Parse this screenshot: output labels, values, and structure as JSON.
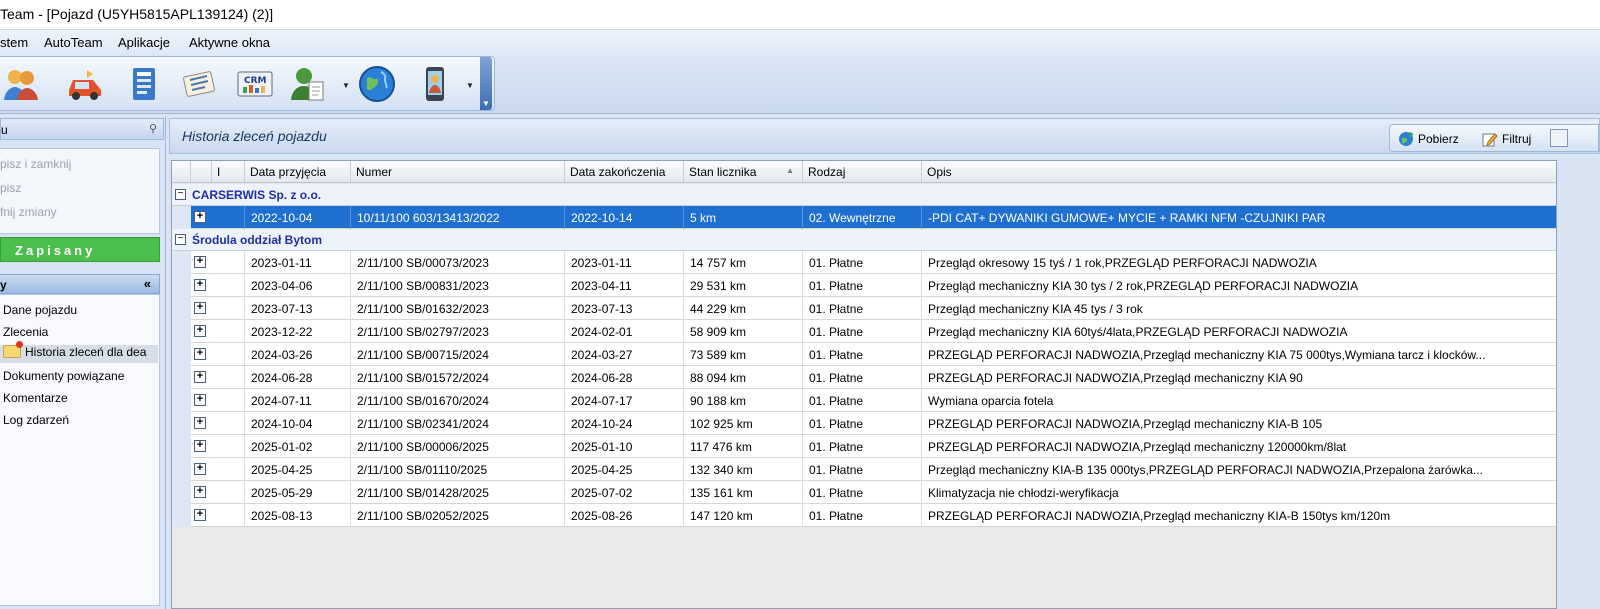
{
  "window": {
    "title": "Team - [Pojazd (U5YH5815APL139124) (2)]"
  },
  "menu": [
    {
      "label": "stem"
    },
    {
      "label": "AutoTeam"
    },
    {
      "label": "Aplikacje"
    },
    {
      "label": "Aktywne okna"
    }
  ],
  "toolbar": {
    "icons": [
      "customers-icon",
      "car-icon",
      "document-icon",
      "notes-icon",
      "crm-icon",
      "user-document-icon",
      "globe-icon",
      "mobile-icon"
    ]
  },
  "left_panel": {
    "header_label": "u",
    "actions": [
      "pisz i zamknij",
      "pisz",
      "fnij zmiany"
    ],
    "saved_label": "Zapisany",
    "nav_header": "y",
    "nav_items": [
      "Dane pojazdu",
      "Zlecenia",
      "Historia zleceń dla dea",
      "Dokumenty powiązane",
      "Komentarze",
      "Log zdarzeń"
    ]
  },
  "main": {
    "title": "Historia zleceń pojazdu",
    "buttons": {
      "fetch": "Pobierz",
      "filter": "Filtruj"
    }
  },
  "grid": {
    "columns": [
      "I",
      "Data przyjęcia",
      "Numer",
      "Data zakończenia",
      "Stan licznika",
      "Rodzaj",
      "Opis"
    ],
    "sort_indicator": "▲",
    "groups": [
      {
        "name": "CARSERWIS Sp. z o.o.",
        "rows": [
          {
            "data_przyjecia": "2022-10-04",
            "numer": "10/11/100 603/13413/2022",
            "data_zakonczenia": "2022-10-14",
            "stan_licznika": "5 km",
            "rodzaj": "02. Wewnętrzne",
            "opis": "-PDI CAT+ DYWANIKI GUMOWE+ MYCIE + RAMKI NFM -CZUJNIKI PAR"
          }
        ]
      },
      {
        "name": "Środula oddział Bytom",
        "rows": [
          {
            "data_przyjecia": "2023-01-11",
            "numer": "2/11/100 SB/00073/2023",
            "data_zakonczenia": "2023-01-11",
            "stan_licznika": "14 757 km",
            "rodzaj": "01. Płatne",
            "opis": "Przegląd okresowy 15 tyś / 1 rok,PRZEGLĄD PERFORACJI NADWOZIA"
          },
          {
            "data_przyjecia": "2023-04-06",
            "numer": "2/11/100 SB/00831/2023",
            "data_zakonczenia": "2023-04-11",
            "stan_licznika": "29 531 km",
            "rodzaj": "01. Płatne",
            "opis": "Przegląd mechaniczny KIA 30 tys / 2 rok,PRZEGLĄD PERFORACJI NADWOZIA"
          },
          {
            "data_przyjecia": "2023-07-13",
            "numer": "2/11/100 SB/01632/2023",
            "data_zakonczenia": "2023-07-13",
            "stan_licznika": "44 229 km",
            "rodzaj": "01. Płatne",
            "opis": "Przegląd mechaniczny KIA 45 tys / 3 rok"
          },
          {
            "data_przyjecia": "2023-12-22",
            "numer": "2/11/100 SB/02797/2023",
            "data_zakonczenia": "2024-02-01",
            "stan_licznika": "58 909 km",
            "rodzaj": "01. Płatne",
            "opis": "Przegląd mechaniczny KIA 60tyś/4lata,PRZEGLĄD PERFORACJI NADWOZIA"
          },
          {
            "data_przyjecia": "2024-03-26",
            "numer": "2/11/100 SB/00715/2024",
            "data_zakonczenia": "2024-03-27",
            "stan_licznika": "73 589 km",
            "rodzaj": "01. Płatne",
            "opis": "PRZEGLĄD PERFORACJI NADWOZIA,Przegląd mechaniczny KIA 75 000tys,Wymiana tarcz i klocków..."
          },
          {
            "data_przyjecia": "2024-06-28",
            "numer": "2/11/100 SB/01572/2024",
            "data_zakonczenia": "2024-06-28",
            "stan_licznika": "88 094 km",
            "rodzaj": "01. Płatne",
            "opis": "PRZEGLĄD PERFORACJI NADWOZIA,Przegląd mechaniczny KIA 90"
          },
          {
            "data_przyjecia": "2024-07-11",
            "numer": "2/11/100 SB/01670/2024",
            "data_zakonczenia": "2024-07-17",
            "stan_licznika": "90 188 km",
            "rodzaj": "01. Płatne",
            "opis": "Wymiana oparcia fotela"
          },
          {
            "data_przyjecia": "2024-10-04",
            "numer": "2/11/100 SB/02341/2024",
            "data_zakonczenia": "2024-10-24",
            "stan_licznika": "102 925 km",
            "rodzaj": "01. Płatne",
            "opis": "PRZEGLĄD PERFORACJI NADWOZIA,Przegląd mechaniczny KIA-B  105"
          },
          {
            "data_przyjecia": "2025-01-02",
            "numer": "2/11/100 SB/00006/2025",
            "data_zakonczenia": "2025-01-10",
            "stan_licznika": "117 476 km",
            "rodzaj": "01. Płatne",
            "opis": "PRZEGLĄD PERFORACJI NADWOZIA,Przegląd mechaniczny 120000km/8lat"
          },
          {
            "data_przyjecia": "2025-04-25",
            "numer": "2/11/100 SB/01110/2025",
            "data_zakonczenia": "2025-04-25",
            "stan_licznika": "132 340 km",
            "rodzaj": "01. Płatne",
            "opis": "Przegląd mechaniczny  KIA-B 135 000tys,PRZEGLĄD PERFORACJI NADWOZIA,Przepalona żarówka..."
          },
          {
            "data_przyjecia": "2025-05-29",
            "numer": "2/11/100 SB/01428/2025",
            "data_zakonczenia": "2025-07-02",
            "stan_licznika": "135 161 km",
            "rodzaj": "01. Płatne",
            "opis": "Klimatyzacja nie chłodzi-weryfikacja"
          },
          {
            "data_przyjecia": "2025-08-13",
            "numer": "2/11/100 SB/02052/2025",
            "data_zakonczenia": "2025-08-26",
            "stan_licznika": "147 120 km",
            "rodzaj": "01. Płatne",
            "opis": "PRZEGLĄD PERFORACJI NADWOZIA,Przegląd mechaniczny KIA-B 150tys km/120m"
          }
        ]
      }
    ]
  }
}
